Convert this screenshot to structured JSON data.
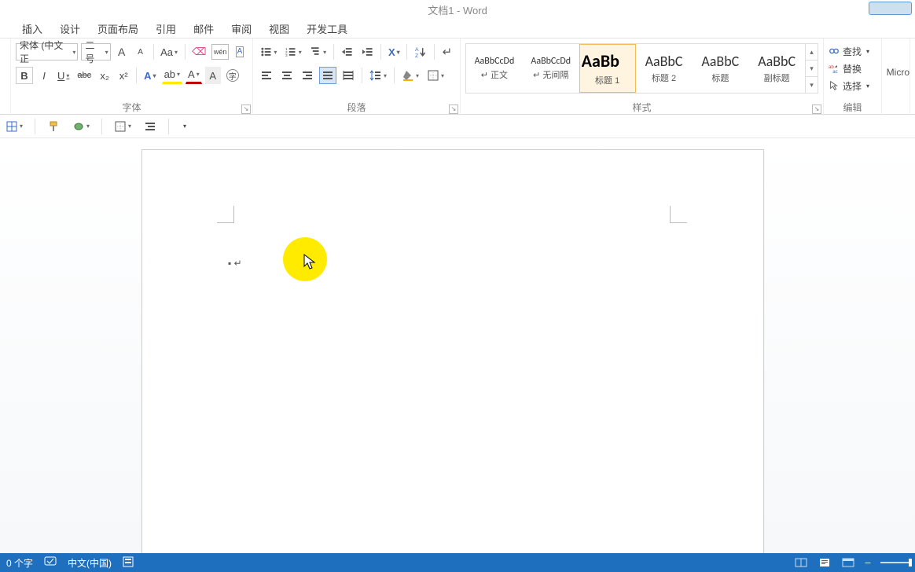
{
  "title": "文档1 - Word",
  "tabs": [
    "插入",
    "设计",
    "页面布局",
    "引用",
    "邮件",
    "审阅",
    "视图",
    "开发工具"
  ],
  "font": {
    "family": "宋体 (中文正",
    "size": "二号",
    "grow": "A",
    "shrink": "A",
    "case": "Aa",
    "clear": "⌫",
    "phonetic": "wén",
    "char_border": "A",
    "bold": "B",
    "italic": "I",
    "underline": "U",
    "strike": "abc",
    "sub": "x₂",
    "sup": "x²",
    "text_effects": "A",
    "highlight": "ab",
    "font_color": "A",
    "char_shading": "A",
    "enclose": "字",
    "group": "字体"
  },
  "paragraph": {
    "bullets": "•—",
    "numbering": "1—",
    "multilevel": "≡",
    "dec_indent": "≤",
    "inc_indent": "≥",
    "asian": "X",
    "sort": "A↓",
    "show_marks": "¶",
    "align_left": "≡",
    "align_center": "≡",
    "align_right": "≡",
    "justify": "≡",
    "distribute": "≡",
    "line_spacing": "↕",
    "shading": "◧",
    "border": "⊞",
    "group": "段落"
  },
  "styles": {
    "group": "样式",
    "items": [
      {
        "preview": "AaBbCcDd",
        "name": "正文",
        "size": "12px",
        "weight": "normal",
        "prefix": "↵ "
      },
      {
        "preview": "AaBbCcDd",
        "name": "无间隔",
        "size": "12px",
        "weight": "normal",
        "prefix": "↵ "
      },
      {
        "preview": "AaBb",
        "name": "标题 1",
        "size": "22px",
        "weight": "bold",
        "prefix": ""
      },
      {
        "preview": "AaBbC",
        "name": "标题 2",
        "size": "18px",
        "weight": "normal",
        "prefix": ""
      },
      {
        "preview": "AaBbC",
        "name": "标题",
        "size": "18px",
        "weight": "normal",
        "prefix": ""
      },
      {
        "preview": "AaBbC",
        "name": "副标题",
        "size": "18px",
        "weight": "normal",
        "prefix": ""
      }
    ]
  },
  "editing": {
    "find": "查找",
    "replace": "替换",
    "select": "选择",
    "group": "编辑"
  },
  "cutoff": "Micro",
  "status": {
    "words": "0 个字",
    "lang": "中文(中国)"
  },
  "cursor_text": "▪  ↵"
}
